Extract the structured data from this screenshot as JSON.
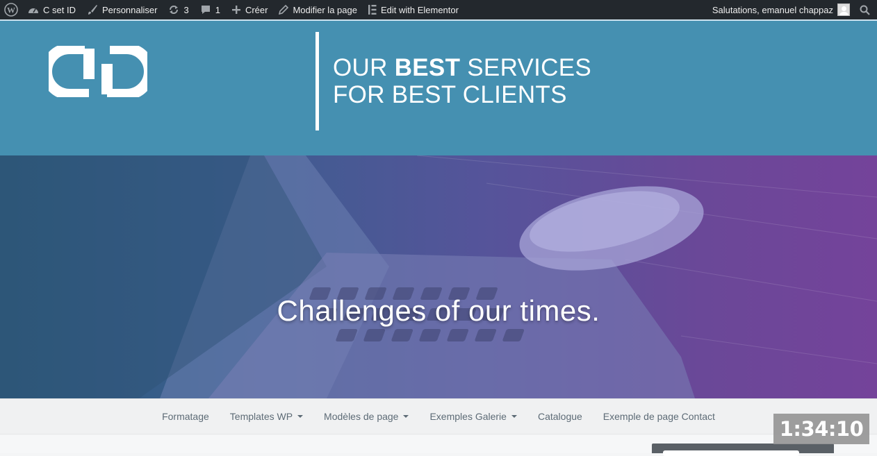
{
  "adminbar": {
    "site_name": "C set ID",
    "customize": "Personnaliser",
    "updates_count": "3",
    "comments_count": "1",
    "new": "Créer",
    "edit_page": "Modifier la page",
    "elementor": "Edit with Elementor",
    "greeting": "Salutations, emanuel chappaz"
  },
  "header": {
    "tagline_line1_pre": "OUR ",
    "tagline_line1_bold": "BEST",
    "tagline_line1_post": " SERVICES",
    "tagline_line2": "FOR BEST CLIENTS"
  },
  "hero": {
    "title": "Challenges of our times."
  },
  "nav": {
    "items": [
      {
        "label": "Formatage"
      },
      {
        "label": "Templates WP"
      },
      {
        "label": "Modèles de page"
      },
      {
        "label": "Exemples Galerie"
      },
      {
        "label": "Catalogue"
      },
      {
        "label": "Exemple de page Contact"
      }
    ]
  },
  "overlay": {
    "timer": "1:34:10"
  },
  "colors": {
    "adminbar": "#23282d",
    "header": "#4590b1",
    "hero_left": "#2c5a7a",
    "hero_right": "#74439a",
    "nav_text": "#5d6b76"
  }
}
